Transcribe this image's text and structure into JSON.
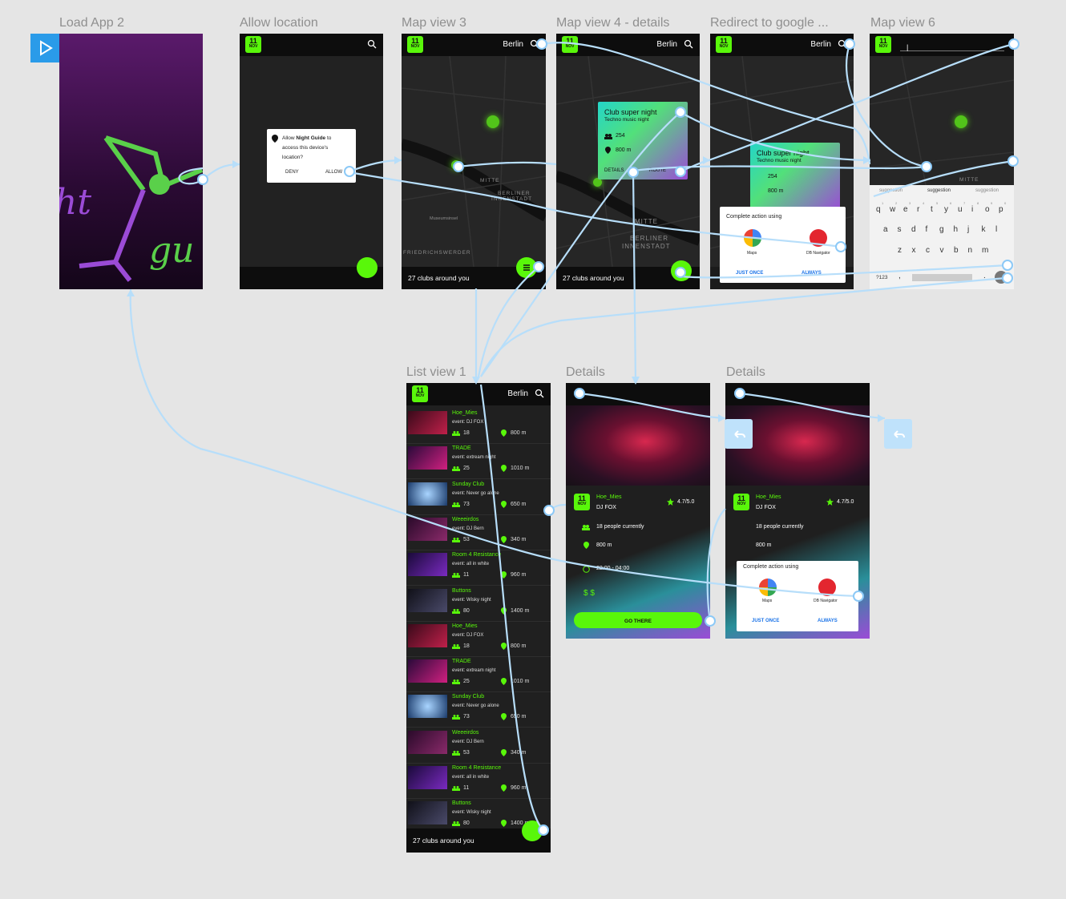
{
  "frames": {
    "load_app": {
      "title": "Load App 2",
      "logo_text_1": "ht",
      "logo_text_2": "gu"
    },
    "allow_location": {
      "title": "Allow location",
      "date_day": "11",
      "date_month": "NOV",
      "dialog_line1_pre": "Allow ",
      "dialog_app": "Night Guide",
      "dialog_line1_post": " to",
      "dialog_line2": "access this device's",
      "dialog_line3": "location?",
      "deny": "DENY",
      "allow": "ALLOW"
    },
    "map3": {
      "title": "Map view 3",
      "city": "Berlin",
      "footer": "27 clubs around you",
      "labels": [
        "MITTE",
        "BERLINER",
        "INNENSTADT",
        "FRIEDRICHSWERDER",
        "Museumsinsel"
      ]
    },
    "map4": {
      "title": "Map view 4 - details",
      "city": "Berlin",
      "card_title": "Club super night",
      "card_sub": "Techno music night",
      "card_people": "254",
      "card_dist": "800 m",
      "details_btn": "DETAILS",
      "route_btn": "ROUTE",
      "footer": "27 clubs around you",
      "labels": [
        "MITTE",
        "BERLINER",
        "INNENSTADT"
      ]
    },
    "redirect": {
      "title": "Redirect to google ...",
      "city": "Berlin",
      "card_title": "Club super night",
      "card_sub": "Techno music night",
      "card_people": "254",
      "card_dist": "800 m",
      "complete": "Complete action using",
      "maps": "Maps",
      "db": "DB Navigator",
      "once": "JUST ONCE",
      "always": "ALWAYS"
    },
    "map6": {
      "title": "Map view 6",
      "search_value": "|",
      "label": "MITTE",
      "suggestions": [
        "suggestion",
        "suggestion",
        "suggestion"
      ],
      "row1": [
        "q",
        "w",
        "e",
        "r",
        "t",
        "y",
        "u",
        "i",
        "o",
        "p"
      ],
      "row1_nums": [
        "1",
        "2",
        "3",
        "4",
        "5",
        "6",
        "7",
        "8",
        "9",
        "0"
      ],
      "row2": [
        "a",
        "s",
        "d",
        "f",
        "g",
        "h",
        "j",
        "k",
        "l"
      ],
      "row3": [
        "z",
        "x",
        "c",
        "v",
        "b",
        "n",
        "m"
      ],
      "sym": "?123",
      "comma": ",",
      "dot": "."
    },
    "list1": {
      "title": "List view 1",
      "city": "Berlin",
      "footer": "27 clubs around you",
      "rows": [
        {
          "name": "Hoe_Mies",
          "event": "event:  DJ FOX",
          "people": "18",
          "dist": "800 m"
        },
        {
          "name": "TRADE",
          "event": "event:  extream night",
          "people": "25",
          "dist": "1010 m"
        },
        {
          "name": "Sunday Club",
          "event": "event:  Never go alone",
          "people": "73",
          "dist": "650 m"
        },
        {
          "name": "Weeeirdos",
          "event": "event:  DJ  Bern",
          "people": "53",
          "dist": "340 m"
        },
        {
          "name": "Room 4 Resistance",
          "event": "event:  all in white",
          "people": "11",
          "dist": "960 m"
        },
        {
          "name": "Buttons",
          "event": "event:  Wisky night",
          "people": "80",
          "dist": "1400 m"
        },
        {
          "name": "Hoe_Mies",
          "event": "event:  DJ FOX",
          "people": "18",
          "dist": "800 m"
        },
        {
          "name": "TRADE",
          "event": "event:  extream night",
          "people": "25",
          "dist": "1010 m"
        },
        {
          "name": "Sunday Club",
          "event": "event:  Never go alone",
          "people": "73",
          "dist": "650 m"
        },
        {
          "name": "Weeeirdos",
          "event": "event:  DJ  Bern",
          "people": "53",
          "dist": "340 m"
        },
        {
          "name": "Room 4 Resistance",
          "event": "event:  all in white",
          "people": "11",
          "dist": "960 m"
        },
        {
          "name": "Buttons",
          "event": "event:  Wisky night",
          "people": "80",
          "dist": "1400 m"
        }
      ]
    },
    "details1": {
      "title": "Details",
      "club": "Hoe_Mies",
      "dj": "DJ FOX",
      "rating": "4.7/5.0",
      "people": "18 people currently",
      "dist": "800 m",
      "hours": "22:00 - 04:00",
      "price": "$ $",
      "go": "GO THERE"
    },
    "details2": {
      "title": "Details",
      "club": "Hoe_Mies",
      "dj": "DJ FOX",
      "rating": "4.7/5.0",
      "people": "18 people currently",
      "dist": "800 m",
      "complete": "Complete action using",
      "maps": "Maps",
      "db": "DB Navigator",
      "once": "JUST ONCE",
      "always": "ALWAYS"
    }
  },
  "colors": {
    "accent": "#59f70a",
    "link": "#8cc9f7",
    "canvas": "#e5e5e5"
  },
  "icons": [
    "play-icon",
    "search-icon",
    "location-pin-icon",
    "people-icon",
    "list-icon",
    "star-icon",
    "clock-icon",
    "back-arrow-icon",
    "google-maps-icon",
    "db-navigator-icon"
  ]
}
